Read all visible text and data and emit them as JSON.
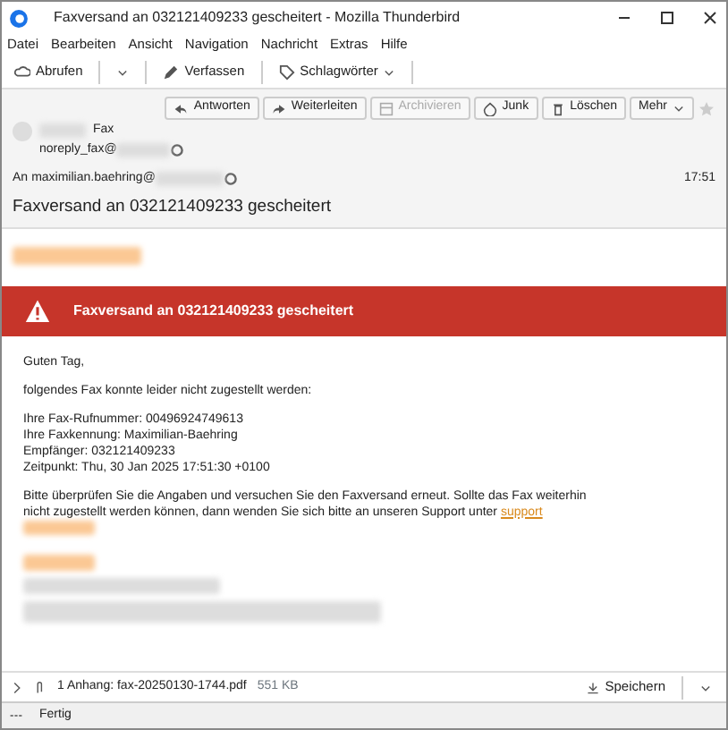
{
  "window": {
    "title": "Faxversand an 032121409233 gescheitert - Mozilla Thunderbird"
  },
  "menu": [
    "Datei",
    "Bearbeiten",
    "Ansicht",
    "Navigation",
    "Nachricht",
    "Extras",
    "Hilfe"
  ],
  "toolbar": [
    {
      "label": "Abrufen",
      "kind": "get"
    },
    {
      "label": "Verfassen",
      "kind": "write"
    },
    {
      "label": "Schlagwörter",
      "kind": "tag"
    }
  ],
  "actions": [
    {
      "label": "Antworten",
      "kind": "reply",
      "disabled": false
    },
    {
      "label": "Weiterleiten",
      "kind": "forward",
      "disabled": false
    },
    {
      "label": "Archivieren",
      "kind": "archive",
      "disabled": true
    },
    {
      "label": "Junk",
      "kind": "junk",
      "disabled": false
    },
    {
      "label": "Löschen",
      "kind": "delete",
      "disabled": false
    },
    {
      "label": "Mehr",
      "kind": "more",
      "disabled": false
    }
  ],
  "header": {
    "from_name": "Fax",
    "from_address": "noreply_fax@",
    "to_label": "An",
    "to_address": "maximilian.baehring@",
    "time": "17:51",
    "subject": "Faxversand an 032121409233 gescheitert"
  },
  "banner": {
    "text": "Faxversand an 032121409233 gescheitert"
  },
  "body": {
    "greeting": "Guten Tag,",
    "intro": "folgendes Fax konnte leider nicht zugestellt werden:",
    "details": [
      "Ihre Fax-Rufnummer: 00496924749613",
      "Ihre Faxkennung: Maximilian-Baehring",
      "Empfänger: 032121409233",
      "Zeitpunkt: Thu, 30 Jan 2025 17:51:30 +0100"
    ],
    "closing": "Bitte überprüfen Sie die Angaben und versuchen Sie den Faxversand erneut. Sollte das Fax weiterhin nicht zugestellt werden können, dann wenden Sie sich bitte an unseren Support unter ",
    "link": "support"
  },
  "attachment": {
    "label": "1 Anhang: fax-20250130-1744.pdf",
    "size": "551 KB",
    "save": "Speichern"
  },
  "status": {
    "text": "Fertig"
  }
}
